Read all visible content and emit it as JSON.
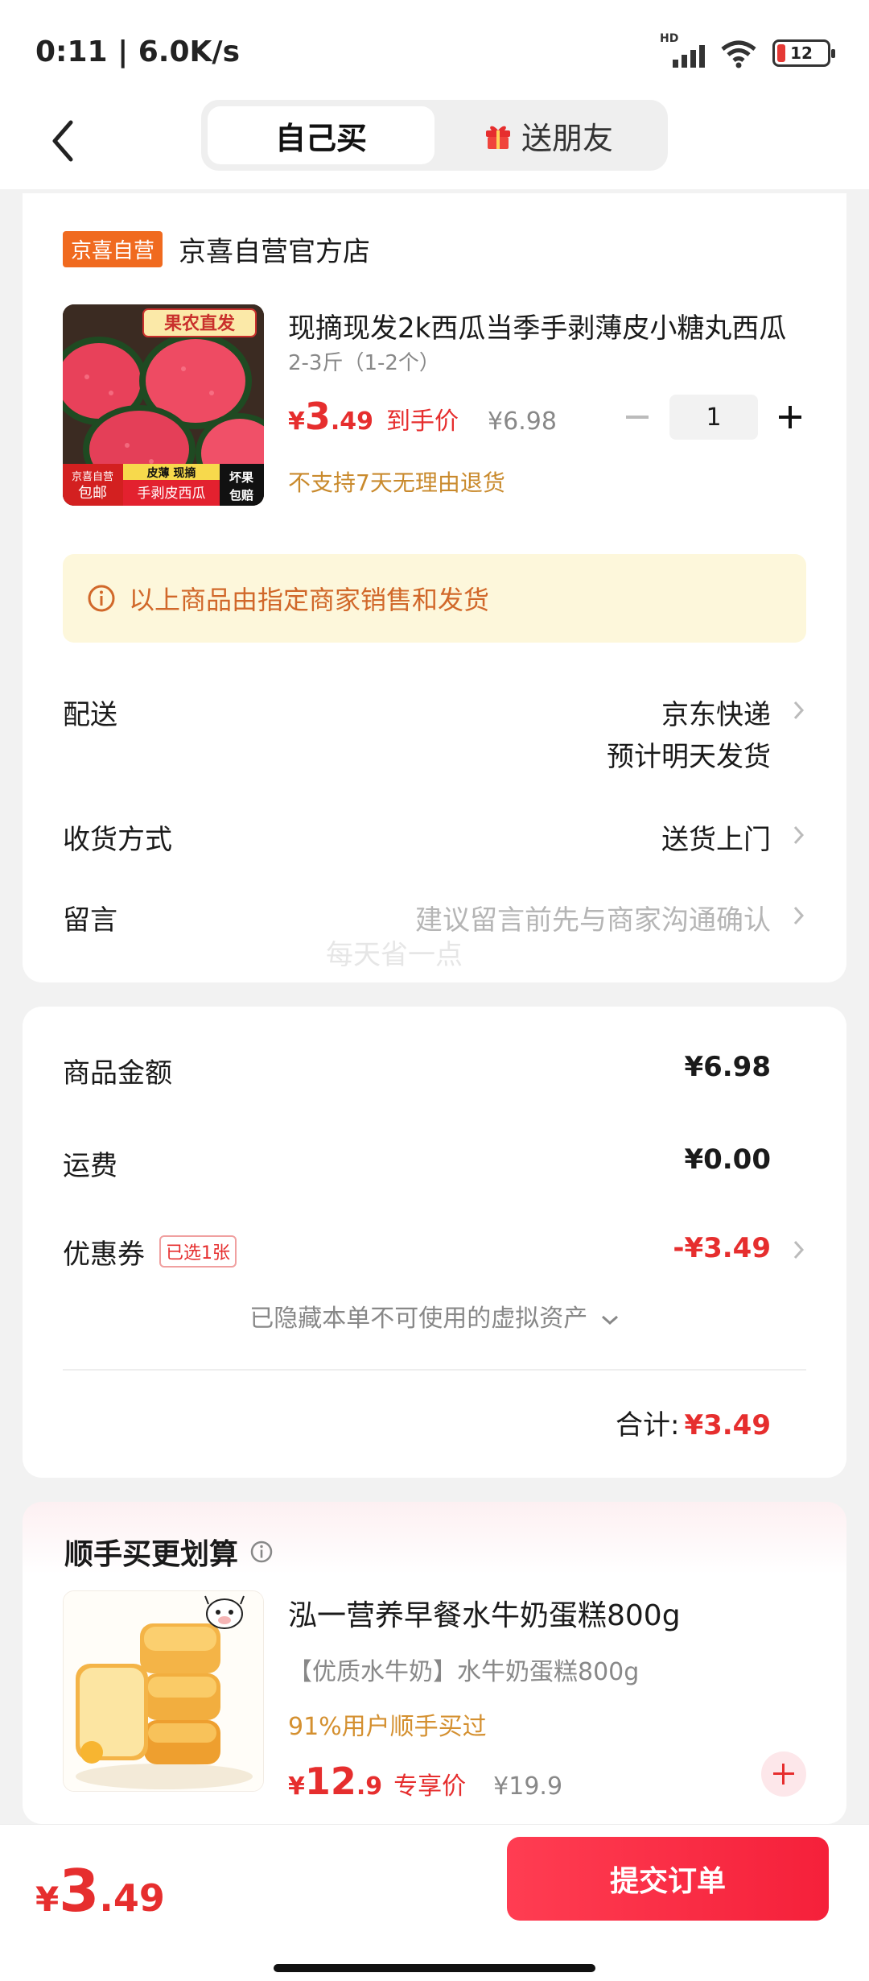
{
  "status": {
    "time_speed": "0:11 | 6.0K/s",
    "hd": "HD",
    "battery": "12"
  },
  "nav": {
    "tabs": [
      {
        "label": "自己买"
      },
      {
        "label": "送朋友"
      }
    ]
  },
  "store": {
    "tag": "京喜自营",
    "name": "京喜自营官方店"
  },
  "product": {
    "title": "现摘现发2k西瓜当季手剥薄皮小糖丸西瓜",
    "spec": "2-3斤（1-2个）",
    "price_yen": "¥",
    "price_int": "3",
    "price_dec": ".49",
    "price_label": "到手价",
    "original_price": "¥6.98",
    "quantity": "1",
    "return_policy": "不支持7天无理由退货",
    "image_badges": {
      "top": "果农直发",
      "left": "京喜自营 包邮",
      "mid_top": "皮薄 现摘",
      "mid_bottom": "手剥皮西瓜",
      "right": "坏果 包赔"
    }
  },
  "notice": {
    "text": "以上商品由指定商家销售和发货"
  },
  "delivery": {
    "label": "配送",
    "value": "京东快递",
    "sub": "预计明天发货",
    "method_label": "收货方式",
    "method_value": "送货上门",
    "message_label": "留言",
    "message_placeholder": "建议留言前先与商家沟通确认"
  },
  "watermark": "每天省一点",
  "summary": {
    "goods_label": "商品金额",
    "goods_value": "¥6.98",
    "shipping_label": "运费",
    "shipping_value": "¥0.00",
    "coupon_label": "优惠券",
    "coupon_tag": "已选1张",
    "coupon_value": "-¥3.49",
    "hidden_assets": "已隐藏本单不可使用的虚拟资产",
    "total_label": "合计:",
    "total_value": "¥3.49"
  },
  "recommend": {
    "title": "顺手买更划算",
    "name": "泓一营养早餐水牛奶蛋糕800g",
    "sub": "【优质水牛奶】水牛奶蛋糕800g",
    "stat": "91%用户顺手买过",
    "price_yen": "¥",
    "price_int": "12",
    "price_dec": ".9",
    "price_label": "专享价",
    "original_price": "¥19.9"
  },
  "bottom": {
    "yen": "¥",
    "price_int": "3",
    "price_dec": ".49",
    "submit_label": "提交订单"
  },
  "colors": {
    "brand_red": "#e62e2e",
    "store_tag_orange": "#f06a1f",
    "notice_bg": "#fdf7db",
    "notice_text": "#d1682a"
  }
}
